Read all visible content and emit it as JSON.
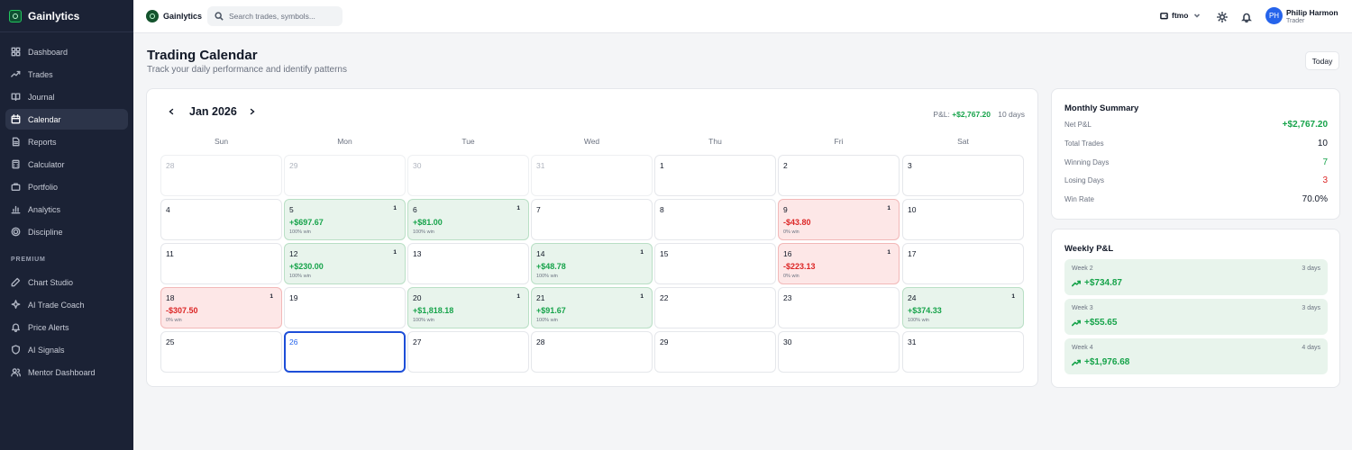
{
  "brand": {
    "name": "Gainlytics"
  },
  "sidebar": {
    "items": [
      {
        "label": "Dashboard",
        "icon": "dashboard-icon"
      },
      {
        "label": "Trades",
        "icon": "trending-up-icon"
      },
      {
        "label": "Journal",
        "icon": "book-icon"
      },
      {
        "label": "Calendar",
        "icon": "calendar-icon",
        "active": true
      },
      {
        "label": "Reports",
        "icon": "file-text-icon"
      },
      {
        "label": "Calculator",
        "icon": "calculator-icon"
      },
      {
        "label": "Portfolio",
        "icon": "briefcase-icon"
      },
      {
        "label": "Analytics",
        "icon": "bar-chart-icon"
      },
      {
        "label": "Discipline",
        "icon": "target-icon"
      }
    ],
    "premium_label": "PREMIUM",
    "premium_items": [
      {
        "label": "Chart Studio",
        "icon": "pen-icon"
      },
      {
        "label": "AI Trade Coach",
        "icon": "sparkles-icon"
      },
      {
        "label": "Price Alerts",
        "icon": "bell-icon"
      },
      {
        "label": "AI Signals",
        "icon": "shield-icon"
      },
      {
        "label": "Mentor Dashboard",
        "icon": "users-icon"
      }
    ]
  },
  "header": {
    "brand": "Gainlytics",
    "search_placeholder": "Search trades, symbols...",
    "account": "ftmo",
    "user_initials": "PH",
    "user_name": "Philip Harmon",
    "user_role": "Trader"
  },
  "page": {
    "title": "Trading Calendar",
    "subtitle": "Track your daily performance and identify patterns",
    "today_label": "Today"
  },
  "calendar": {
    "month": "Jan 2026",
    "pnl_label": "P&L: ",
    "pnl_value": "+$2,767.20",
    "days_label": "10 days",
    "weekdays": [
      "Sun",
      "Mon",
      "Tue",
      "Wed",
      "Thu",
      "Fri",
      "Sat"
    ],
    "cells": [
      {
        "day": "28",
        "other": true
      },
      {
        "day": "29",
        "other": true
      },
      {
        "day": "30",
        "other": true
      },
      {
        "day": "31",
        "other": true
      },
      {
        "day": "1"
      },
      {
        "day": "2"
      },
      {
        "day": "3"
      },
      {
        "day": "4"
      },
      {
        "day": "5",
        "status": "win",
        "count": "1",
        "pnl": "+$697.67",
        "winrate": "100% win"
      },
      {
        "day": "6",
        "status": "win",
        "count": "1",
        "pnl": "+$81.00",
        "winrate": "100% win"
      },
      {
        "day": "7"
      },
      {
        "day": "8"
      },
      {
        "day": "9",
        "status": "loss",
        "count": "1",
        "pnl": "-$43.80",
        "winrate": "0% win"
      },
      {
        "day": "10"
      },
      {
        "day": "11"
      },
      {
        "day": "12",
        "status": "win",
        "count": "1",
        "pnl": "+$230.00",
        "winrate": "100% win"
      },
      {
        "day": "13"
      },
      {
        "day": "14",
        "status": "win",
        "count": "1",
        "pnl": "+$48.78",
        "winrate": "100% win"
      },
      {
        "day": "15"
      },
      {
        "day": "16",
        "status": "loss",
        "count": "1",
        "pnl": "-$223.13",
        "winrate": "0% win"
      },
      {
        "day": "17"
      },
      {
        "day": "18",
        "status": "loss",
        "count": "1",
        "pnl": "-$307.50",
        "winrate": "0% win"
      },
      {
        "day": "19"
      },
      {
        "day": "20",
        "status": "win",
        "count": "1",
        "pnl": "+$1,818.18",
        "winrate": "100% win"
      },
      {
        "day": "21",
        "status": "win",
        "count": "1",
        "pnl": "+$91.67",
        "winrate": "100% win"
      },
      {
        "day": "22"
      },
      {
        "day": "23"
      },
      {
        "day": "24",
        "status": "win",
        "count": "1",
        "pnl": "+$374.33",
        "winrate": "100% win"
      },
      {
        "day": "25"
      },
      {
        "day": "26",
        "today": true
      },
      {
        "day": "27"
      },
      {
        "day": "28"
      },
      {
        "day": "29"
      },
      {
        "day": "30"
      },
      {
        "day": "31"
      }
    ]
  },
  "summary": {
    "title": "Monthly Summary",
    "rows": [
      {
        "label": "Net P&L",
        "value": "+$2,767.20",
        "color": "#16a34a"
      },
      {
        "label": "Total Trades",
        "value": "10",
        "color": "#111827"
      },
      {
        "label": "Winning Days",
        "value": "7",
        "color": "#16a34a"
      },
      {
        "label": "Losing Days",
        "value": "3",
        "color": "#dc2626"
      },
      {
        "label": "Win Rate",
        "value": "70.0%",
        "color": "#111827"
      }
    ]
  },
  "weekly": {
    "title": "Weekly P&L",
    "weeks": [
      {
        "label": "Week 2",
        "days": "3 days",
        "value": "+$734.87"
      },
      {
        "label": "Week 3",
        "days": "3 days",
        "value": "+$55.65"
      },
      {
        "label": "Week 4",
        "days": "4 days",
        "value": "+$1,976.68"
      }
    ]
  },
  "colors": {
    "sidebar_bg": "#1b2235",
    "win": "#16a34a",
    "loss": "#dc2626",
    "today_border": "#1d4ed8",
    "avatar": "#2563eb"
  }
}
